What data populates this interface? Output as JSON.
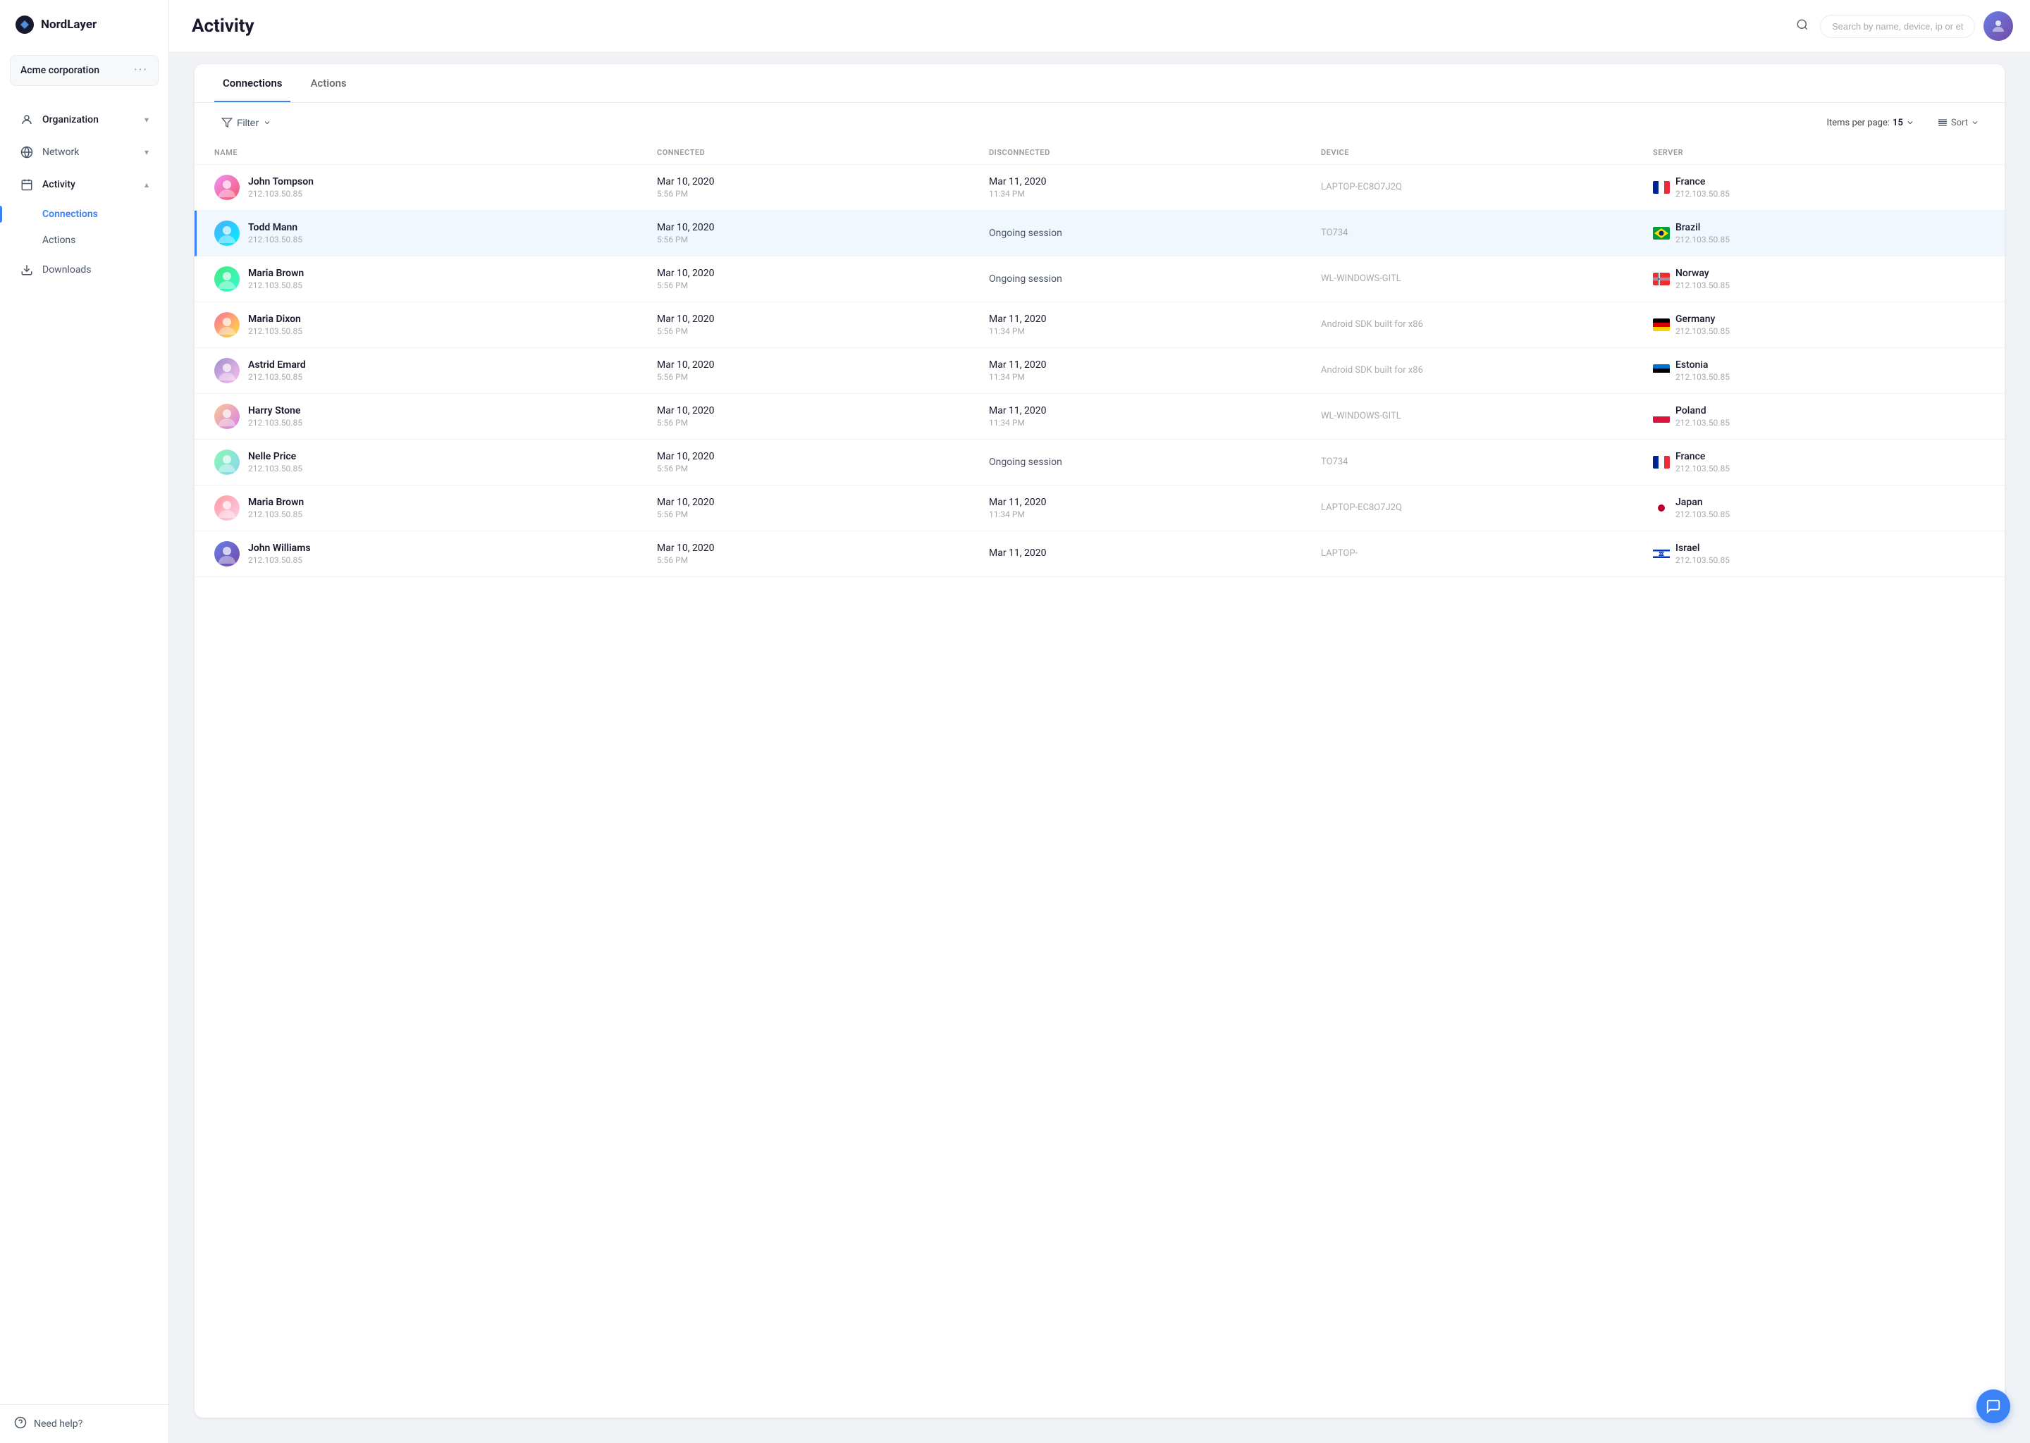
{
  "app": {
    "name": "NordLayer"
  },
  "org": {
    "name": "Acme corporation",
    "dots": "···"
  },
  "sidebar": {
    "items": [
      {
        "id": "organization",
        "label": "Organization",
        "icon": "org",
        "hasChevron": true,
        "expanded": false
      },
      {
        "id": "network",
        "label": "Network",
        "icon": "network",
        "hasChevron": true,
        "expanded": false
      },
      {
        "id": "activity",
        "label": "Activity",
        "icon": "activity",
        "hasChevron": true,
        "expanded": true
      }
    ],
    "subItems": [
      {
        "id": "connections",
        "label": "Connections",
        "active": true
      },
      {
        "id": "actions",
        "label": "Actions",
        "active": false
      }
    ],
    "downloads": {
      "label": "Downloads"
    },
    "needHelp": "Need help?"
  },
  "header": {
    "title": "Activity",
    "search": {
      "placeholder": "Search by name, device, ip or etc."
    }
  },
  "tabs": [
    {
      "id": "connections",
      "label": "Connections",
      "active": true
    },
    {
      "id": "actions",
      "label": "Actions",
      "active": false
    }
  ],
  "toolbar": {
    "filter_label": "Filter",
    "items_per_page_label": "Items per page:",
    "items_per_page_value": "15",
    "sort_label": "Sort"
  },
  "table": {
    "columns": [
      "NAME",
      "CONNECTED",
      "DISCONNECTED",
      "DEVICE",
      "SERVER"
    ],
    "rows": [
      {
        "name": "John Tompson",
        "ip": "212.103.50.85",
        "connected_date": "Mar 10, 2020",
        "connected_time": "5:56 PM",
        "disconnected_date": "Mar 11, 2020",
        "disconnected_time": "11:34 PM",
        "device": "LAPTOP-EC8O7J2Q",
        "server_country": "France",
        "server_ip": "212.103.50.85",
        "flag_type": "france",
        "highlighted": false,
        "av_class": "av1"
      },
      {
        "name": "Todd Mann",
        "ip": "212.103.50.85",
        "connected_date": "Mar 10, 2020",
        "connected_time": "5:56 PM",
        "disconnected_date": "",
        "disconnected_time": "",
        "disconnected_ongoing": "Ongoing session",
        "device": "TO734",
        "server_country": "Brazil",
        "server_ip": "212.103.50.85",
        "flag_type": "brazil",
        "highlighted": true,
        "av_class": "av2"
      },
      {
        "name": "Maria Brown",
        "ip": "212.103.50.85",
        "connected_date": "Mar 10, 2020",
        "connected_time": "5:56 PM",
        "disconnected_date": "",
        "disconnected_time": "",
        "disconnected_ongoing": "Ongoing session",
        "device": "WL-WINDOWS-GITL",
        "server_country": "Norway",
        "server_ip": "212.103.50.85",
        "flag_type": "norway",
        "highlighted": false,
        "av_class": "av3"
      },
      {
        "name": "Maria Dixon",
        "ip": "212.103.50.85",
        "connected_date": "Mar 10, 2020",
        "connected_time": "5:56 PM",
        "disconnected_date": "Mar 11, 2020",
        "disconnected_time": "11:34 PM",
        "device": "Android SDK built for x86",
        "server_country": "Germany",
        "server_ip": "212.103.50.85",
        "flag_type": "germany",
        "highlighted": false,
        "av_class": "av4"
      },
      {
        "name": "Astrid Emard",
        "ip": "212.103.50.85",
        "connected_date": "Mar 10, 2020",
        "connected_time": "5:56 PM",
        "disconnected_date": "Mar 11, 2020",
        "disconnected_time": "11:34 PM",
        "device": "Android SDK built for x86",
        "server_country": "Estonia",
        "server_ip": "212.103.50.85",
        "flag_type": "estonia",
        "highlighted": false,
        "av_class": "av5"
      },
      {
        "name": "Harry Stone",
        "ip": "212.103.50.85",
        "connected_date": "Mar 10, 2020",
        "connected_time": "5:56 PM",
        "disconnected_date": "Mar 11, 2020",
        "disconnected_time": "11:34 PM",
        "device": "WL-WINDOWS-GITL",
        "server_country": "Poland",
        "server_ip": "212.103.50.85",
        "flag_type": "poland",
        "highlighted": false,
        "av_class": "av6"
      },
      {
        "name": "Nelle Price",
        "ip": "212.103.50.85",
        "connected_date": "Mar 10, 2020",
        "connected_time": "5:56 PM",
        "disconnected_date": "",
        "disconnected_time": "",
        "disconnected_ongoing": "Ongoing session",
        "device": "TO734",
        "server_country": "France",
        "server_ip": "212.103.50.85",
        "flag_type": "france",
        "highlighted": false,
        "av_class": "av7"
      },
      {
        "name": "Maria Brown",
        "ip": "212.103.50.85",
        "connected_date": "Mar 10, 2020",
        "connected_time": "5:56 PM",
        "disconnected_date": "Mar 11, 2020",
        "disconnected_time": "11:34 PM",
        "device": "LAPTOP-EC8O7J2Q",
        "server_country": "Japan",
        "server_ip": "212.103.50.85",
        "flag_type": "japan",
        "highlighted": false,
        "av_class": "av8"
      },
      {
        "name": "John Williams",
        "ip": "212.103.50.85",
        "connected_date": "Mar 10, 2020",
        "connected_time": "5:56 PM",
        "disconnected_date": "Mar 11, 2020",
        "disconnected_time": "",
        "device": "LAPTOP-",
        "server_country": "Israel",
        "server_ip": "212.103.50.85",
        "flag_type": "israel",
        "highlighted": false,
        "av_class": "av9"
      }
    ]
  }
}
